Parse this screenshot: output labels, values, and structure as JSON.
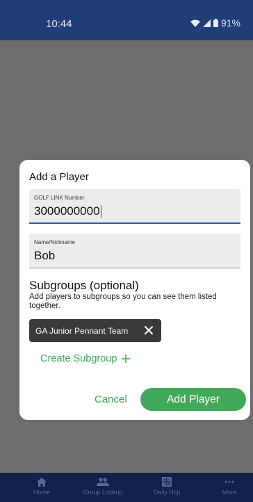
{
  "status": {
    "time": "10:44",
    "battery": "91%"
  },
  "dialog": {
    "title": "Add a Player",
    "golf_link": {
      "label": "GOLF LINK Number",
      "value": "3000000000"
    },
    "name": {
      "label": "Name/Nickname",
      "value": "Bob"
    },
    "subgroups": {
      "title": "Subgroups (optional)",
      "description": "Add players to subgroups so you can see them listed together.",
      "chips": [
        "GA Junior Pennant Team"
      ],
      "create_label": "Create Subgroup"
    },
    "cancel_label": "Cancel",
    "add_label": "Add Player"
  },
  "nav": {
    "items": [
      {
        "label": "Home",
        "icon": "home-icon"
      },
      {
        "label": "Group Lookup",
        "icon": "group-icon"
      },
      {
        "label": "Daily Hcp",
        "icon": "calculator-icon"
      },
      {
        "label": "More",
        "icon": "more-icon"
      }
    ]
  },
  "colors": {
    "brand": "#1f3e77",
    "accent": "#43a95a",
    "nav": "#10224a"
  }
}
